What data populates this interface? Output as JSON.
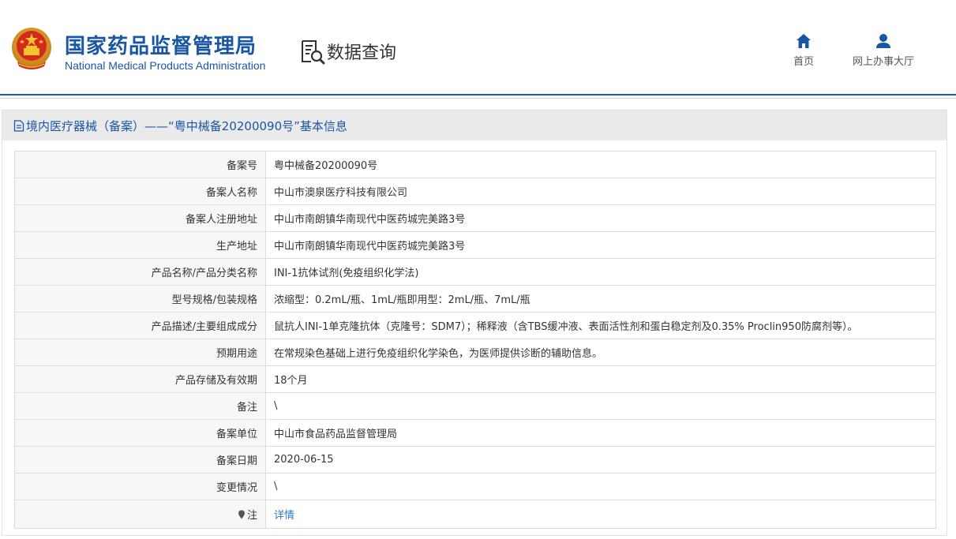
{
  "header": {
    "brand_cn": "国家药品监督管理局",
    "brand_en": "National Medical Products Administration",
    "section": "数据查询",
    "nav": [
      {
        "label": "首页",
        "icon": "home-icon"
      },
      {
        "label": "网上办事大厅",
        "icon": "user-icon"
      }
    ]
  },
  "colors": {
    "brand_blue": "#1a56a6",
    "link_blue": "#2a7bc8",
    "panel_header_bg": "#eaeaea"
  },
  "panel": {
    "title": "境内医疗器械（备案）——“粤中械备20200090号”基本信息"
  },
  "record": [
    {
      "label": "备案号",
      "value": "粤中械备20200090号"
    },
    {
      "label": "备案人名称",
      "value": "中山市澳泉医疗科技有限公司"
    },
    {
      "label": "备案人注册地址",
      "value": "中山市南朗镇华南现代中医药城完美路3号"
    },
    {
      "label": "生产地址",
      "value": "中山市南朗镇华南现代中医药城完美路3号"
    },
    {
      "label": "产品名称/产品分类名称",
      "value": "INI-1抗体试剂(免疫组织化学法)"
    },
    {
      "label": "型号规格/包装规格",
      "value": "浓缩型：0.2mL/瓶、1mL/瓶即用型：2mL/瓶、7mL/瓶"
    },
    {
      "label": "产品描述/主要组成成分",
      "value": "鼠抗人INI-1单克隆抗体（克隆号：SDM7）；稀释液（含TBS缓冲液、表面活性剂和蛋白稳定剂及0.35% Proclin950防腐剂等）。"
    },
    {
      "label": "预期用途",
      "value": "在常规染色基础上进行免疫组织化学染色，为医师提供诊断的辅助信息。"
    },
    {
      "label": "产品存储及有效期",
      "value": "18个月"
    },
    {
      "label": "备注",
      "value": "\\"
    },
    {
      "label": "备案单位",
      "value": "中山市食品药品监督管理局"
    },
    {
      "label": "备案日期",
      "value": "2020-06-15"
    },
    {
      "label": "变更情况",
      "value": "\\"
    }
  ],
  "note": {
    "label": "注",
    "link": "详情"
  }
}
